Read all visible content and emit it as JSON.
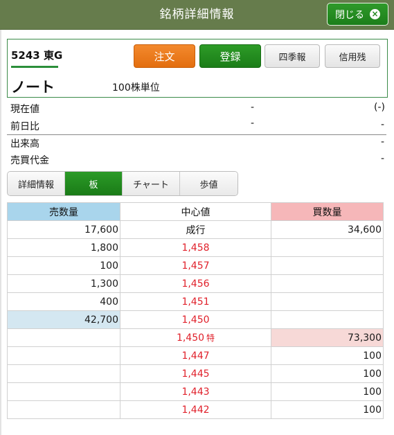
{
  "header": {
    "title": "銘柄詳細情報",
    "close_label": "閉じる",
    "close_icon": "×"
  },
  "stock": {
    "code": "5243 東G",
    "name": "ノート",
    "unit": "100株単位",
    "buttons": {
      "order": "注文",
      "register": "登録",
      "shikiho": "四季報",
      "credit": "信用残"
    }
  },
  "info": {
    "current_price": {
      "label": "現在値",
      "value": "-",
      "change": "(-)"
    },
    "prev_diff": {
      "label": "前日比",
      "value": "-",
      "change": "-"
    },
    "volume": {
      "label": "出来高",
      "value": "-"
    },
    "turnover": {
      "label": "売買代金",
      "value": "-"
    }
  },
  "tabs": [
    "詳細情報",
    "板",
    "チャート",
    "歩値"
  ],
  "active_tab": "板",
  "board": {
    "headers": {
      "sell": "売数量",
      "mid": "中心値",
      "buy": "買数量"
    },
    "rows": [
      {
        "sell": "17,600",
        "price": "成行",
        "buy": "34,600"
      },
      {
        "sell": "1,800",
        "price": "1,458",
        "buy": ""
      },
      {
        "sell": "100",
        "price": "1,457",
        "buy": ""
      },
      {
        "sell": "1,300",
        "price": "1,456",
        "buy": ""
      },
      {
        "sell": "400",
        "price": "1,451",
        "buy": ""
      },
      {
        "sell": "42,700",
        "price": "1,450",
        "buy": ""
      },
      {
        "sell": "",
        "price": "1,450",
        "tag": "特",
        "buy": "73,300"
      },
      {
        "sell": "",
        "price": "1,447",
        "buy": "100"
      },
      {
        "sell": "",
        "price": "1,445",
        "buy": "100"
      },
      {
        "sell": "",
        "price": "1,443",
        "buy": "100"
      },
      {
        "sell": "",
        "price": "1,442",
        "buy": "100"
      }
    ]
  },
  "colors": {
    "header_bg": "#667c4c",
    "green": "#1c7e1a",
    "orange": "#e36e0f",
    "price_red": "#e0202a",
    "sell_blue": "#a9d5ec",
    "buy_pink": "#f6b7b9"
  }
}
